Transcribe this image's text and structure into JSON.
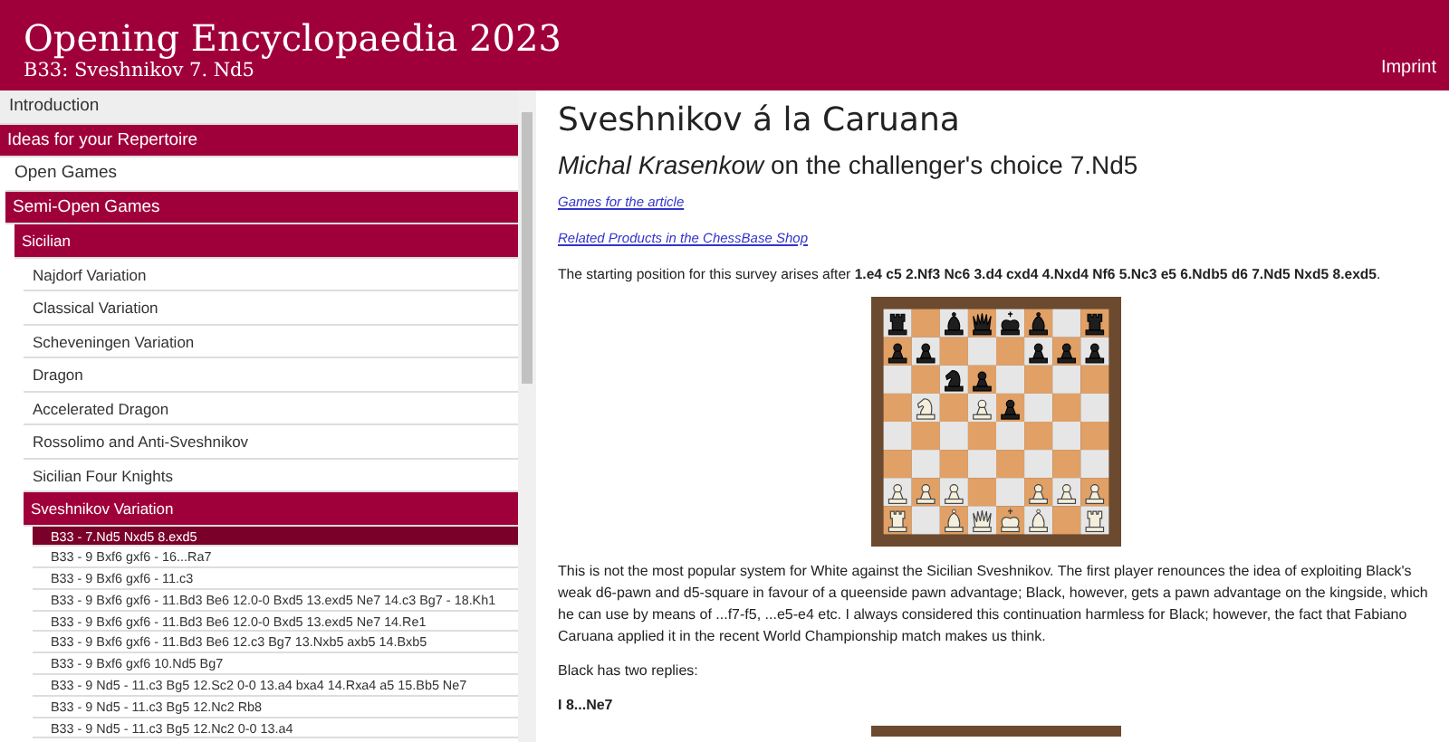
{
  "header": {
    "title": "Opening Encyclopaedia 2023",
    "subtitle": "B33: Sveshnikov 7. Nd5",
    "imprint": "Imprint"
  },
  "sidebar": {
    "items": [
      {
        "label": "Introduction",
        "selected": false,
        "expanded": false
      },
      {
        "label": "Ideas for your Repertoire",
        "selected": false,
        "expanded": true,
        "children": [
          {
            "label": "Open Games",
            "selected": false,
            "expanded": false
          },
          {
            "label": "Semi-Open Games",
            "selected": false,
            "expanded": true,
            "children": [
              {
                "label": "Sicilian",
                "selected": false,
                "expanded": true,
                "children": [
                  {
                    "label": "Najdorf Variation",
                    "selected": false,
                    "expanded": false
                  },
                  {
                    "label": "Classical Variation",
                    "selected": false,
                    "expanded": false
                  },
                  {
                    "label": "Scheveningen Variation",
                    "selected": false,
                    "expanded": false
                  },
                  {
                    "label": "Dragon",
                    "selected": false,
                    "expanded": false
                  },
                  {
                    "label": "Accelerated Dragon",
                    "selected": false,
                    "expanded": false
                  },
                  {
                    "label": "Rossolimo and Anti-Sveshnikov",
                    "selected": false,
                    "expanded": false
                  },
                  {
                    "label": "Sicilian Four Knights",
                    "selected": false,
                    "expanded": false
                  },
                  {
                    "label": "Sveshnikov Variation",
                    "selected": false,
                    "expanded": true,
                    "children": [
                      {
                        "label": "B33 - 7.Nd5 Nxd5 8.exd5",
                        "selected": true
                      },
                      {
                        "label": "B33 - 9 Bxf6 gxf6 - 16...Ra7",
                        "selected": false
                      },
                      {
                        "label": "B33 - 9 Bxf6 gxf6 - 11.c3",
                        "selected": false
                      },
                      {
                        "label": "B33 - 9 Bxf6 gxf6 - 11.Bd3 Be6 12.0-0 Bxd5 13.exd5 Ne7 14.c3 Bg7 - 18.Kh1",
                        "selected": false
                      },
                      {
                        "label": "B33 - 9 Bxf6 gxf6 - 11.Bd3 Be6 12.0-0 Bxd5 13.exd5 Ne7 14.Re1",
                        "selected": false
                      },
                      {
                        "label": "B33 - 9 Bxf6 gxf6 - 11.Bd3 Be6 12.c3 Bg7 13.Nxb5 axb5 14.Bxb5",
                        "selected": false
                      },
                      {
                        "label": "B33 - 9 Bxf6 gxf6 10.Nd5 Bg7",
                        "selected": false
                      },
                      {
                        "label": "B33 - 9 Nd5 - 11.c3 Bg5 12.Sc2 0-0 13.a4 bxa4 14.Rxa4 a5 15.Bb5 Ne7",
                        "selected": false
                      },
                      {
                        "label": "B33 - 9 Nd5 - 11.c3 Bg5 12.Nc2 Rb8",
                        "selected": false
                      },
                      {
                        "label": "B33 - 9 Nd5 - 11.c3 Bg5 12.Nc2 0-0 13.a4",
                        "selected": false
                      }
                    ]
                  }
                ]
              }
            ]
          }
        ]
      }
    ]
  },
  "article": {
    "title": "Sveshnikov á la Caruana",
    "subtitle": "*Michal Krasenkow* on the challenger's choice 7.Nd5",
    "links": [
      "Games for the article",
      "Related Products in the ChessBase Shop"
    ],
    "intro": "The starting position for this survey arises after **1.e4 c5 2.Nf3 Nc6 3.d4 cxd4 4.Nxd4 Nf6 5.Nc3 e5 6.Ndb5 d6 7.Nd5 Nxd5 8.exd5**.",
    "body": "This is not the most popular system for White against the Sicilian Sveshnikov. The first player renounces the idea of exploiting Black's weak d6-pawn and d5-square in favour of a queenside pawn advantage; Black, however, gets a pawn advantage on the kingside, which he can use by means of ...f7-f5, ...e5-e4 etc. I always considered this continuation harmless for Black; however, the fact that Fabiano Caruana applied it in the recent World Championship match makes us think.",
    "replies": "Black has two replies:",
    "section": "I 8...Ne7"
  }
}
